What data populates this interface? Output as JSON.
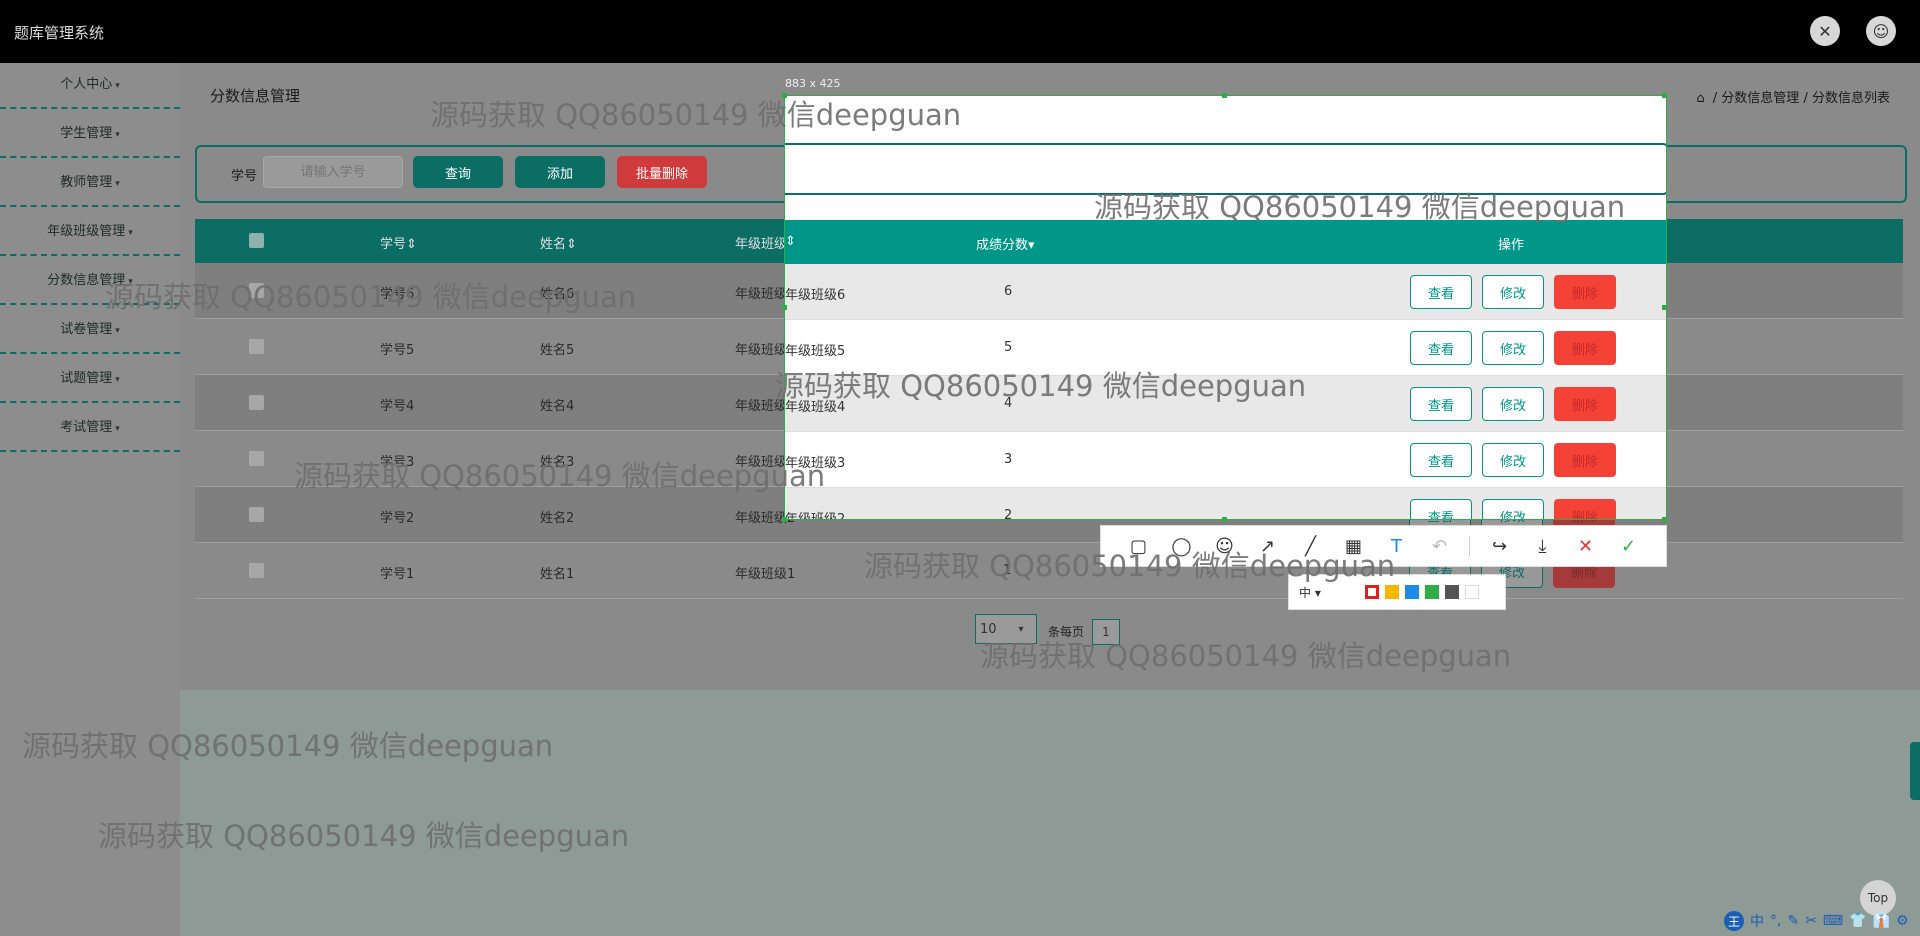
{
  "app": {
    "title": "题库管理系统"
  },
  "header": {
    "icons": [
      "settings-avatar-icon",
      "user-avatar-icon"
    ]
  },
  "sidebar": {
    "items": [
      {
        "label": "个人中心"
      },
      {
        "label": "学生管理"
      },
      {
        "label": "教师管理"
      },
      {
        "label": "年级班级管理"
      },
      {
        "label": "分数信息管理"
      },
      {
        "label": "试卷管理"
      },
      {
        "label": "试题管理"
      },
      {
        "label": "考试管理"
      }
    ]
  },
  "page": {
    "heading": "分数信息管理",
    "breadcrumb": [
      "分数信息管理",
      "分数信息列表"
    ],
    "breadcrumb_sep": "/"
  },
  "search": {
    "label": "学号",
    "placeholder": "请输入学号",
    "query_label": "查询",
    "add_label": "添加",
    "batch_delete_label": "批量删除"
  },
  "table": {
    "headers": [
      "学号",
      "姓名",
      "年级班级",
      "成绩分数",
      "操作"
    ],
    "rows": [
      {
        "id": "学号6",
        "name": "姓名6",
        "class": "年级班级6",
        "score": "6"
      },
      {
        "id": "学号5",
        "name": "姓名5",
        "class": "年级班级5",
        "score": "5"
      },
      {
        "id": "学号4",
        "name": "姓名4",
        "class": "年级班级4",
        "score": "4"
      },
      {
        "id": "学号3",
        "name": "姓名3",
        "class": "年级班级3",
        "score": "3"
      },
      {
        "id": "学号2",
        "name": "姓名2",
        "class": "年级班级2",
        "score": "2"
      },
      {
        "id": "学号1",
        "name": "姓名1",
        "class": "年级班级1",
        "score": "1"
      }
    ],
    "actions": {
      "view": "查看",
      "edit": "修改",
      "delete": "删除"
    }
  },
  "pagination": {
    "page_size": "10",
    "per_page_label": "条每页",
    "current_page": "1"
  },
  "capture_tool": {
    "size_readout": "883 x 425",
    "tools": [
      "rectangle-icon",
      "ellipse-icon",
      "emoji-icon",
      "arrow-icon",
      "line-icon",
      "mosaic-icon",
      "text-icon",
      "undo-icon",
      "share-icon",
      "save-icon",
      "cancel-icon",
      "confirm-icon"
    ],
    "size_option": "中",
    "colors": [
      "#e02020",
      "#f5b800",
      "#1d8ae8",
      "#2fae48",
      "#555555",
      "#ffffff"
    ]
  },
  "watermark": {
    "text": "源码获取 QQ86050149 微信deepguan"
  },
  "top_button": {
    "label": "Top"
  },
  "ime": {
    "logo": "王",
    "items": [
      "中",
      "°,",
      "✎",
      "✂",
      "⌨",
      "👕",
      "👔",
      "⚙"
    ]
  }
}
